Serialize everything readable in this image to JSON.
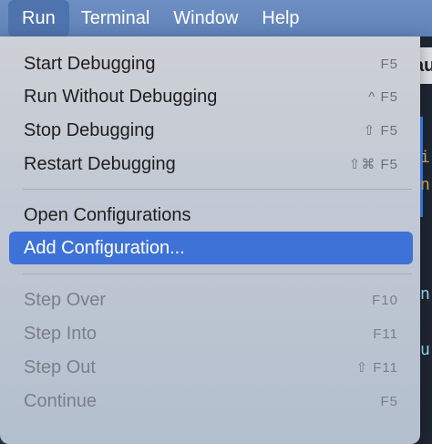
{
  "menubar": {
    "items": [
      "Run",
      "Terminal",
      "Window",
      "Help"
    ],
    "active": "Run"
  },
  "background_window": {
    "tab_fragment": "au",
    "code_chars": [
      "i",
      "n",
      "n",
      "u"
    ]
  },
  "menu": {
    "items": [
      {
        "label": "Start Debugging",
        "shortcut": "F5",
        "enabled": true
      },
      {
        "label": "Run Without Debugging",
        "shortcut": "^ F5",
        "enabled": true
      },
      {
        "label": "Stop Debugging",
        "shortcut": "⇧ F5",
        "enabled": true
      },
      {
        "label": "Restart Debugging",
        "shortcut": "⇧⌘ F5",
        "enabled": true
      },
      {
        "label": "Open Configurations",
        "shortcut": "",
        "enabled": true
      },
      {
        "label": "Add Configuration...",
        "shortcut": "",
        "enabled": true,
        "selected": true
      },
      {
        "label": "Step Over",
        "shortcut": "F10",
        "enabled": false
      },
      {
        "label": "Step Into",
        "shortcut": "F11",
        "enabled": false
      },
      {
        "label": "Step Out",
        "shortcut": "⇧ F11",
        "enabled": false
      },
      {
        "label": "Continue",
        "shortcut": "F5",
        "enabled": false
      }
    ]
  },
  "colors": {
    "menubar": "#5f82b8",
    "selection": "#3e72d6",
    "disabled_text": "#7a7f88"
  }
}
